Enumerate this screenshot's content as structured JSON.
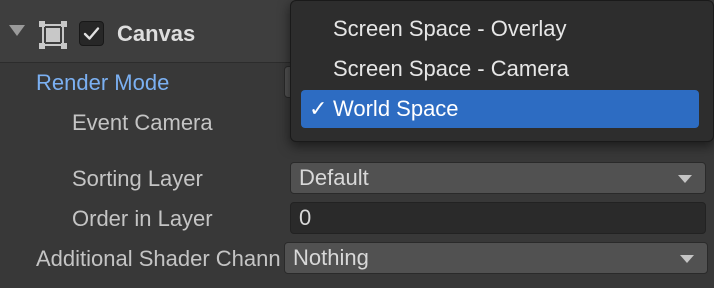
{
  "component": {
    "title": "Canvas",
    "enabled": true
  },
  "properties": {
    "render_mode_label": "Render Mode",
    "event_camera_label": "Event Camera",
    "sorting_layer_label": "Sorting Layer",
    "sorting_layer_value": "Default",
    "order_in_layer_label": "Order in Layer",
    "order_in_layer_value": "0",
    "additional_shader_label": "Additional Shader Channels",
    "additional_shader_value": "Nothing"
  },
  "render_mode_menu": {
    "options": [
      {
        "label": "Screen Space - Overlay",
        "selected": false
      },
      {
        "label": "Screen Space - Camera",
        "selected": false
      },
      {
        "label": "World Space",
        "selected": true
      }
    ],
    "check_glyph": "✓"
  },
  "colors": {
    "accent_label": "#7bb0f2",
    "selection": "#2d6cc2"
  }
}
